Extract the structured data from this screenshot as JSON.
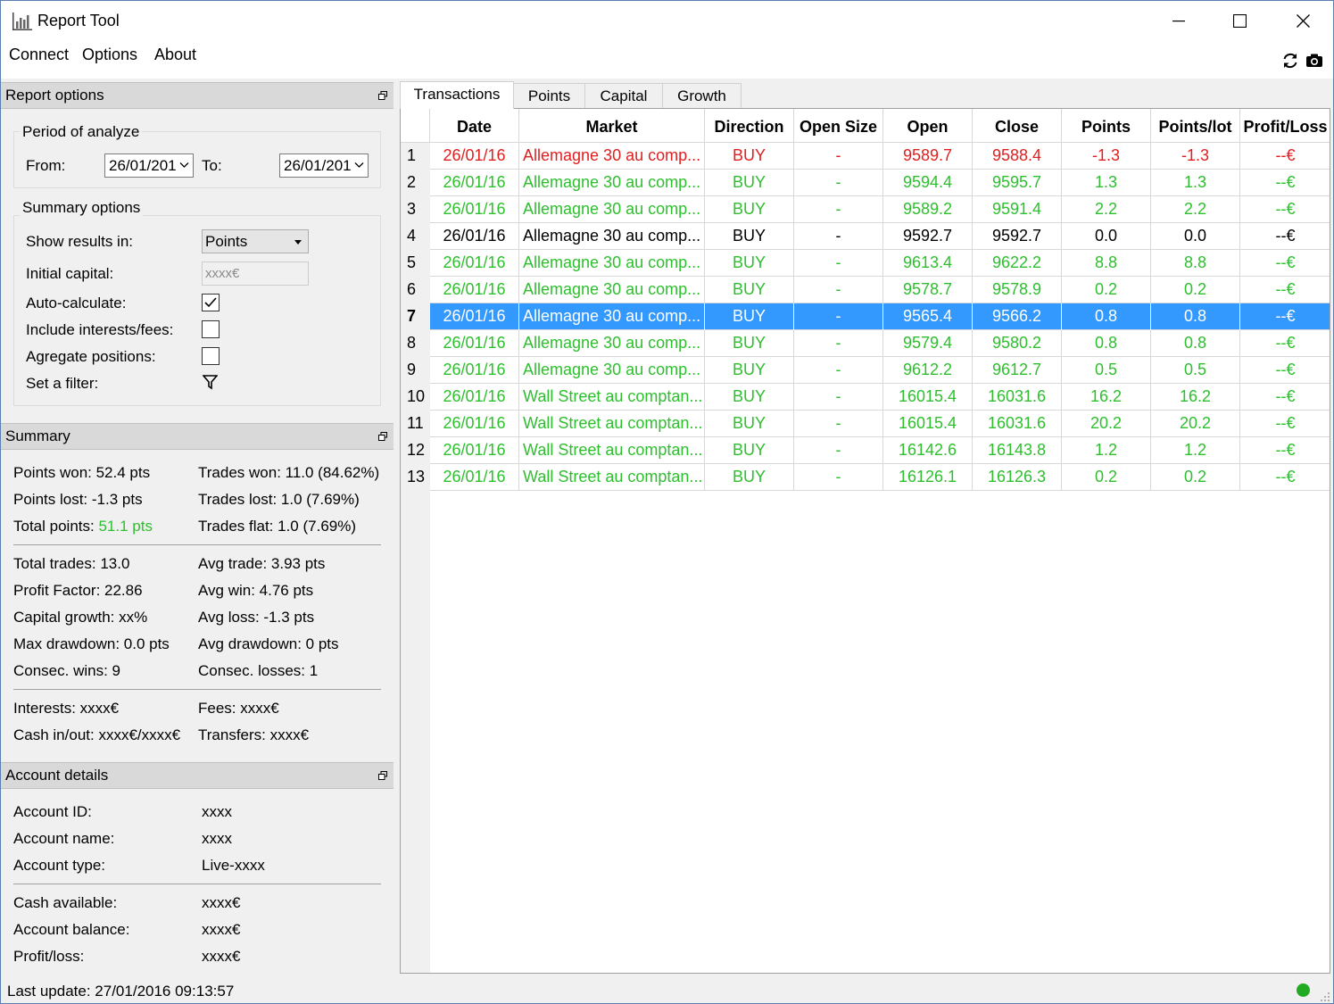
{
  "window": {
    "title": "Report Tool",
    "controls": {
      "minimize": "─",
      "maximize": "☐",
      "close": "✕"
    }
  },
  "menu": [
    "Connect",
    "Options",
    "About"
  ],
  "toolbar_icons": [
    "refresh-icon",
    "camera-icon"
  ],
  "report_options": {
    "header": "Report options",
    "period": {
      "title": "Period of analyze",
      "from_label": "From:",
      "from_value": "26/01/201",
      "to_label": "To:",
      "to_value": "26/01/201"
    },
    "summary_options": {
      "title": "Summary options",
      "show_results_label": "Show results in:",
      "show_results_value": "Points",
      "initial_capital_label": "Initial capital:",
      "initial_capital_placeholder": "xxxx€",
      "auto_calculate_label": "Auto-calculate:",
      "auto_calculate_checked": true,
      "include_interests_label": "Include interests/fees:",
      "include_interests_checked": false,
      "aggregate_label": "Agregate positions:",
      "aggregate_checked": false,
      "filter_label": "Set a filter:"
    }
  },
  "summary": {
    "header": "Summary",
    "points_won": "Points won: 52.4 pts",
    "trades_won": "Trades won: 11.0 (84.62%)",
    "points_lost": "Points lost: -1.3 pts",
    "trades_lost": "Trades lost: 1.0 (7.69%)",
    "total_points_label": "Total points:",
    "total_points_value": "51.1 pts",
    "trades_flat": "Trades flat: 1.0 (7.69%)",
    "total_trades": "Total trades: 13.0",
    "avg_trade": "Avg trade: 3.93 pts",
    "profit_factor": "Profit Factor: 22.86",
    "avg_win": "Avg win: 4.76 pts",
    "capital_growth": "Capital growth: xx%",
    "avg_loss": "Avg loss: -1.3 pts",
    "max_drawdown": "Max drawdown: 0.0 pts",
    "avg_drawdown": "Avg drawdown: 0 pts",
    "consec_wins": "Consec. wins: 9",
    "consec_losses": "Consec. losses: 1",
    "interests": "Interests: xxxx€",
    "fees": "Fees: xxxx€",
    "cash_inout": "Cash in/out: xxxx€/xxxx€",
    "transfers": "Transfers: xxxx€"
  },
  "account": {
    "header": "Account details",
    "id_label": "Account ID:",
    "id_value": "xxxx",
    "name_label": "Account name:",
    "name_value": "xxxx",
    "type_label": "Account type:",
    "type_value": "Live-xxxx",
    "cash_label": "Cash available:",
    "cash_value": "xxxx€",
    "balance_label": "Account balance:",
    "balance_value": "xxxx€",
    "pl_label": "Profit/loss:",
    "pl_value": "xxxx€"
  },
  "tabs": [
    "Transactions",
    "Points",
    "Capital",
    "Growth"
  ],
  "table": {
    "columns": [
      "Date",
      "Market",
      "Direction",
      "Open Size",
      "Open",
      "Close",
      "Points",
      "Points/lot",
      "Profit/Loss"
    ],
    "colors": {
      "red": "#e02020",
      "green": "#2ebf2e",
      "black": "#000000",
      "selected": "#3399ff"
    },
    "selected_row": 7,
    "rows": [
      {
        "n": "1",
        "color": "red",
        "cells": [
          "26/01/16",
          "Allemagne 30 au comp...",
          "BUY",
          "-",
          "9589.7",
          "9588.4",
          "-1.3",
          "-1.3",
          "--€"
        ]
      },
      {
        "n": "2",
        "color": "green",
        "cells": [
          "26/01/16",
          "Allemagne 30 au comp...",
          "BUY",
          "-",
          "9594.4",
          "9595.7",
          "1.3",
          "1.3",
          "--€"
        ]
      },
      {
        "n": "3",
        "color": "green",
        "cells": [
          "26/01/16",
          "Allemagne 30 au comp...",
          "BUY",
          "-",
          "9589.2",
          "9591.4",
          "2.2",
          "2.2",
          "--€"
        ]
      },
      {
        "n": "4",
        "color": "black",
        "cells": [
          "26/01/16",
          "Allemagne 30 au comp...",
          "BUY",
          "-",
          "9592.7",
          "9592.7",
          "0.0",
          "0.0",
          "--€"
        ]
      },
      {
        "n": "5",
        "color": "green",
        "cells": [
          "26/01/16",
          "Allemagne 30 au comp...",
          "BUY",
          "-",
          "9613.4",
          "9622.2",
          "8.8",
          "8.8",
          "--€"
        ]
      },
      {
        "n": "6",
        "color": "green",
        "cells": [
          "26/01/16",
          "Allemagne 30 au comp...",
          "BUY",
          "-",
          "9578.7",
          "9578.9",
          "0.2",
          "0.2",
          "--€"
        ]
      },
      {
        "n": "7",
        "color": "green",
        "cells": [
          "26/01/16",
          "Allemagne 30 au comp...",
          "BUY",
          "-",
          "9565.4",
          "9566.2",
          "0.8",
          "0.8",
          "--€"
        ]
      },
      {
        "n": "8",
        "color": "green",
        "cells": [
          "26/01/16",
          "Allemagne 30 au comp...",
          "BUY",
          "-",
          "9579.4",
          "9580.2",
          "0.8",
          "0.8",
          "--€"
        ]
      },
      {
        "n": "9",
        "color": "green",
        "cells": [
          "26/01/16",
          "Allemagne 30 au comp...",
          "BUY",
          "-",
          "9612.2",
          "9612.7",
          "0.5",
          "0.5",
          "--€"
        ]
      },
      {
        "n": "10",
        "color": "green",
        "cells": [
          "26/01/16",
          "Wall Street au comptan...",
          "BUY",
          "-",
          "16015.4",
          "16031.6",
          "16.2",
          "16.2",
          "--€"
        ]
      },
      {
        "n": "11",
        "color": "green",
        "cells": [
          "26/01/16",
          "Wall Street au comptan...",
          "BUY",
          "-",
          "16015.4",
          "16031.6",
          "20.2",
          "20.2",
          "--€"
        ]
      },
      {
        "n": "12",
        "color": "green",
        "cells": [
          "26/01/16",
          "Wall Street au comptan...",
          "BUY",
          "-",
          "16142.6",
          "16143.8",
          "1.2",
          "1.2",
          "--€"
        ]
      },
      {
        "n": "13",
        "color": "green",
        "cells": [
          "26/01/16",
          "Wall Street au comptan...",
          "BUY",
          "-",
          "16126.1",
          "16126.3",
          "0.2",
          "0.2",
          "--€"
        ]
      }
    ]
  },
  "status": {
    "last_update": "Last update: 27/01/2016 09:13:57",
    "connection_color": "#22aa22"
  }
}
